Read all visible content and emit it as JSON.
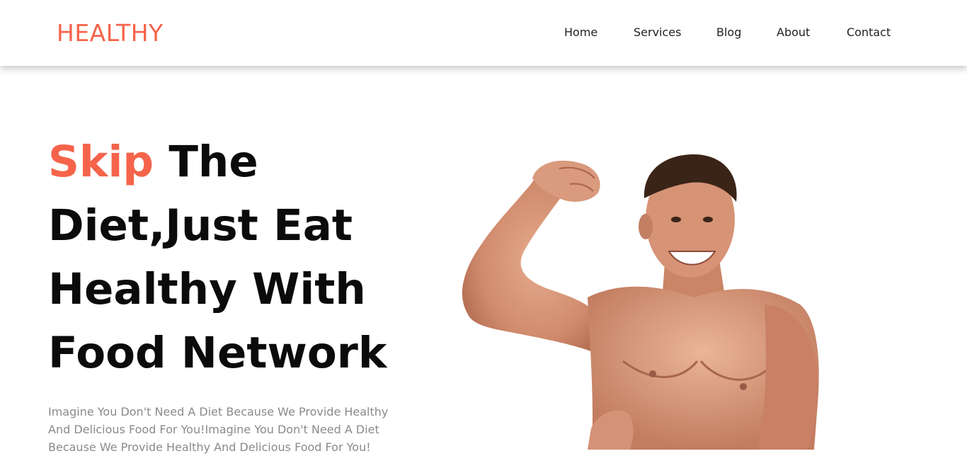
{
  "navbar": {
    "brand": "HEALTHY",
    "links": [
      "Home",
      "Services",
      "Blog",
      "About",
      "Contact"
    ]
  },
  "hero": {
    "title_accent": "Skip",
    "title_rest": " The Diet,Just Eat Healthy With Food Network",
    "description": "Imagine You Don't Need A Diet Because We Provide Healthy And Delicious Food For You!Imagine You Don't Need A Diet Because We Provide Healthy And Delicious Food For You!"
  },
  "colors": {
    "accent": "#f5644a",
    "title": "#0b0b0b",
    "nav_text": "#222222",
    "body_text": "#8a8a8a",
    "skin": "#d9957a"
  },
  "images": {
    "hero": "flexing-muscular-man-photo"
  }
}
